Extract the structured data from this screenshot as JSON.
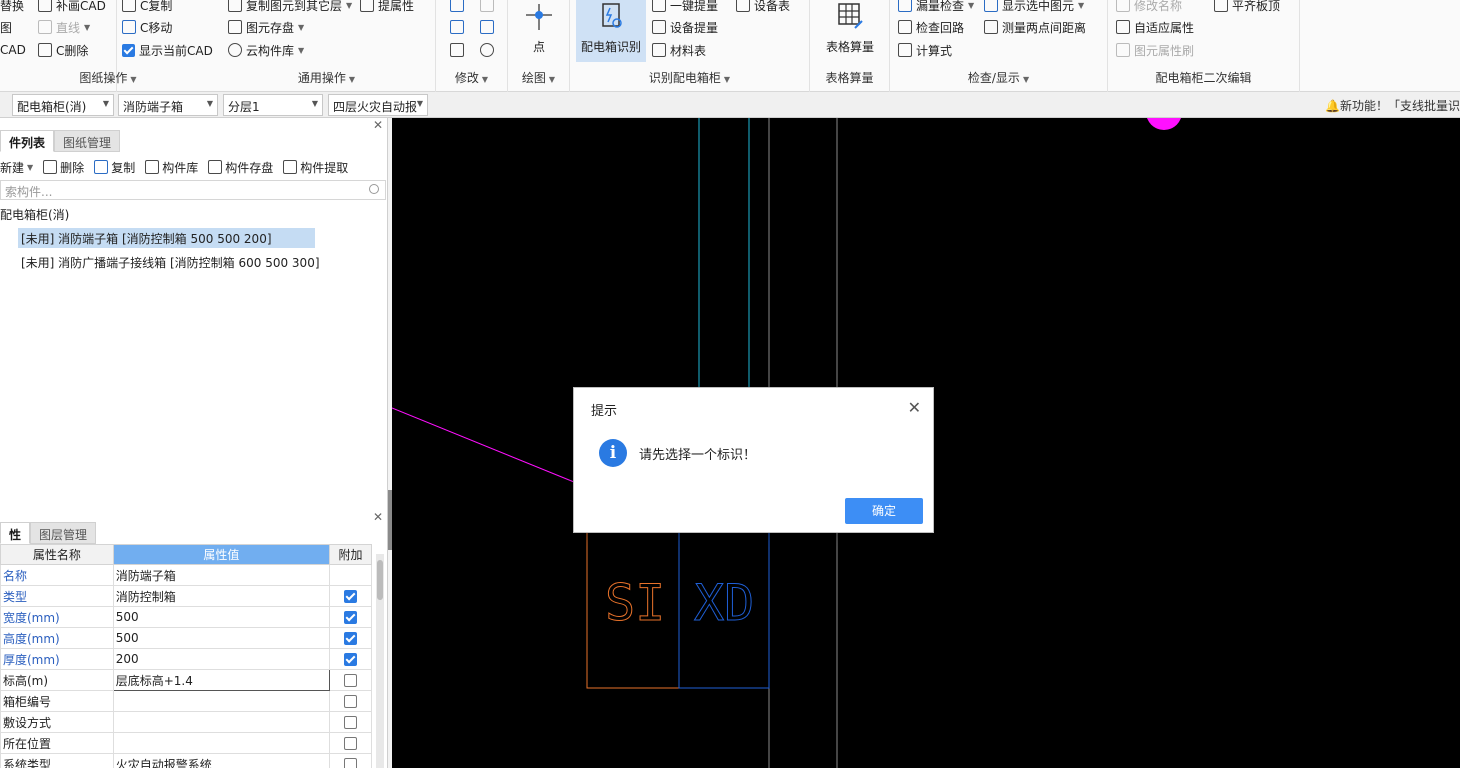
{
  "ribbon": {
    "groups": {
      "drawing_ops": {
        "label": "图纸操作",
        "items": [
          "替换",
          "补画CAD",
          "C复制",
          "直线",
          "C移动",
          "C删除",
          "显示当前CAD"
        ],
        "left_partials": [
          "图",
          "CAD"
        ]
      },
      "common_ops": {
        "label": "通用操作",
        "items": [
          "复制图元到其它层",
          "提属性",
          "图元存盘",
          "云构件库"
        ]
      },
      "modify": {
        "label": "修改"
      },
      "draw": {
        "label": "绘图",
        "point": "点"
      },
      "identify": {
        "label": "识别配电箱柜",
        "big": "配电箱识别",
        "items": [
          "一键提量",
          "设备表",
          "设备提量",
          "材料表"
        ]
      },
      "table_calc": {
        "label": "表格算量",
        "big": "表格算量"
      },
      "check": {
        "label": "检查/显示",
        "items": [
          "漏量检查",
          "显示选中图元",
          "检查回路",
          "测量两点间距离",
          "计算式"
        ]
      },
      "secondary": {
        "label": "配电箱柜二次编辑",
        "items": [
          "修改名称",
          "平齐板顶",
          "自适应属性",
          "图元属性刷"
        ]
      }
    }
  },
  "toolbar": {
    "combo1": "配电箱柜(消)",
    "combo2": "消防端子箱",
    "combo3": "分层1",
    "combo4": "四层火灾自动报",
    "notice": "新功能！「支线批量识"
  },
  "left_top": {
    "tabs": [
      "件列表",
      "图纸管理"
    ],
    "tools": [
      "新建",
      "删除",
      "复制",
      "构件库",
      "构件存盘",
      "构件提取"
    ],
    "search_placeholder": "索构件...",
    "tree_root": "配电箱柜(消)",
    "tree_items": [
      "[未用] 消防端子箱 [消防控制箱 500 500 200]",
      "[未用] 消防广播端子接线箱 [消防控制箱 600 500 300]"
    ]
  },
  "left_bottom": {
    "tabs": [
      "性",
      "图层管理"
    ],
    "headers": [
      "属性名称",
      "属性值",
      "附加"
    ],
    "rows": [
      {
        "name": "名称",
        "value": "消防端子箱",
        "blue": true,
        "check": "none"
      },
      {
        "name": "类型",
        "value": "消防控制箱",
        "blue": true,
        "check": "on"
      },
      {
        "name": "宽度(mm)",
        "value": "500",
        "blue": true,
        "check": "on"
      },
      {
        "name": "高度(mm)",
        "value": "500",
        "blue": true,
        "check": "on"
      },
      {
        "name": "厚度(mm)",
        "value": "200",
        "blue": true,
        "check": "on"
      },
      {
        "name": "标高(m)",
        "value": "层底标高+1.4",
        "blue": false,
        "check": "off"
      },
      {
        "name": "箱柜编号",
        "value": "",
        "blue": false,
        "check": "off"
      },
      {
        "name": "敷设方式",
        "value": "",
        "blue": false,
        "check": "off"
      },
      {
        "name": "所在位置",
        "value": "",
        "blue": false,
        "check": "off"
      },
      {
        "name": "系统类型",
        "value": "火灾自动报警系统",
        "blue": false,
        "check": "off"
      }
    ]
  },
  "canvas": {
    "labels": {
      "si": "SI",
      "xd": "XD"
    },
    "colors": {
      "bg": "#000000",
      "cyan": "#1fb7d6",
      "gray": "#8a8a8a",
      "magenta": "#ff10ff",
      "orange": "#e8722a",
      "blue": "#1f5fd6"
    }
  },
  "dialog": {
    "title": "提示",
    "message": "请先选择一个标识！",
    "ok": "确定"
  }
}
